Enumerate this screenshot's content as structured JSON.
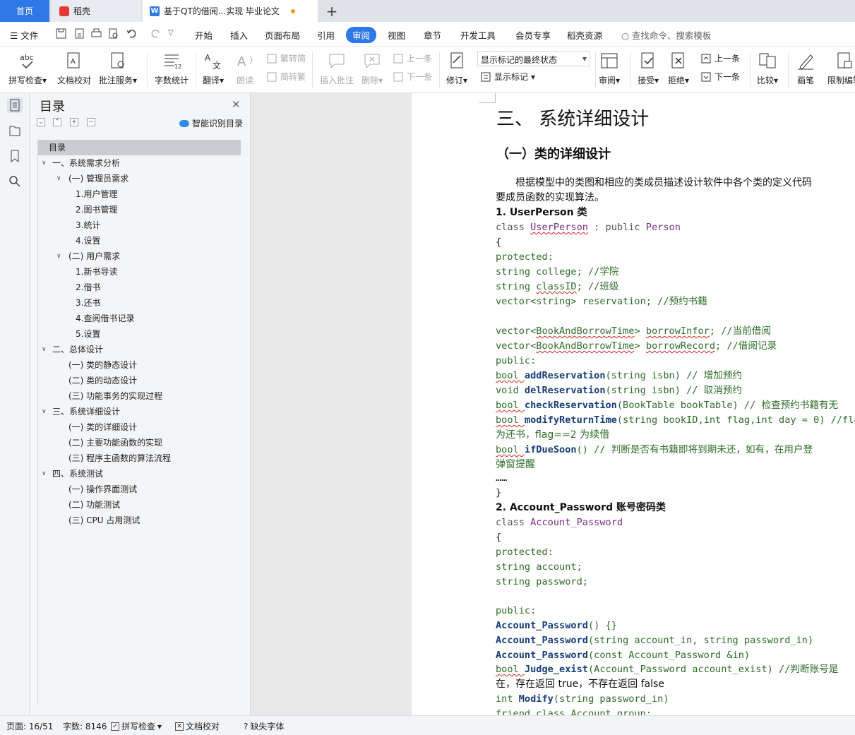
{
  "tabs": {
    "home": "首页",
    "daoke": "稻壳",
    "doc": "基于QT的借阅...实现 毕业论文",
    "new_tab": "+"
  },
  "menu": {
    "file": "文件",
    "items": [
      "开始",
      "插入",
      "页面布局",
      "引用",
      "审阅",
      "视图",
      "章节",
      "开发工具",
      "会员专享",
      "稻壳资源"
    ],
    "search": "查找命令、搜索模板"
  },
  "ribbon": {
    "spell": "拼写检查",
    "proof": "文档校对",
    "annotate": "批注服务",
    "wordcount": "字数统计",
    "translate": "翻译",
    "read": "朗读",
    "trad": "繁转简",
    "simp": "简转繁",
    "insert_comment": "插入批注",
    "delete": "删除",
    "prev_comment": "上一条",
    "next_comment": "下一条",
    "revise": "修订",
    "markup_state": "显示标记的最终状态",
    "show_markup": "显示标记",
    "review": "审阅",
    "accept": "接受",
    "reject": "拒绝",
    "prev": "上一条",
    "next": "下一条",
    "compare": "比较",
    "pen": "画笔",
    "restrict": "限制编辑"
  },
  "toc": {
    "title": "目录",
    "smart": "智能识别目录",
    "items": [
      {
        "text": "目录",
        "level": 0,
        "caret": ""
      },
      {
        "text": "一、系统需求分析",
        "level": 1,
        "caret": "v"
      },
      {
        "text": "(一) 管理员需求",
        "level": 2,
        "caret": "v"
      },
      {
        "text": "1.用户管理",
        "level": 3,
        "caret": ""
      },
      {
        "text": "2.图书管理",
        "level": 3,
        "caret": ""
      },
      {
        "text": "3.统计",
        "level": 3,
        "caret": ""
      },
      {
        "text": "4.设置",
        "level": 3,
        "caret": ""
      },
      {
        "text": "(二) 用户需求",
        "level": 2,
        "caret": "v"
      },
      {
        "text": "1.新书导读",
        "level": 3,
        "caret": ""
      },
      {
        "text": "2.借书",
        "level": 3,
        "caret": ""
      },
      {
        "text": "3.还书",
        "level": 3,
        "caret": ""
      },
      {
        "text": "4.查阅借书记录",
        "level": 3,
        "caret": ""
      },
      {
        "text": "5.设置",
        "level": 3,
        "caret": ""
      },
      {
        "text": "二、总体设计",
        "level": 1,
        "caret": "v"
      },
      {
        "text": "(一) 类的静态设计",
        "level": 2,
        "caret": ""
      },
      {
        "text": "(二) 类的动态设计",
        "level": 2,
        "caret": ""
      },
      {
        "text": "(三) 功能事务的实现过程",
        "level": 2,
        "caret": ""
      },
      {
        "text": "三、系统详细设计",
        "level": 1,
        "caret": "v"
      },
      {
        "text": "(一) 类的详细设计",
        "level": 2,
        "caret": ""
      },
      {
        "text": "(二) 主要功能函数的实现",
        "level": 2,
        "caret": ""
      },
      {
        "text": "(三) 程序主函数的算法流程",
        "level": 2,
        "caret": ""
      },
      {
        "text": "四、系统测试",
        "level": 1,
        "caret": "v"
      },
      {
        "text": "(一) 操作界面测试",
        "level": 2,
        "caret": ""
      },
      {
        "text": "(二) 功能测试",
        "level": 2,
        "caret": ""
      },
      {
        "text": "(三) CPU 占用测试",
        "level": 2,
        "caret": ""
      }
    ]
  },
  "doc": {
    "h1": "三、 系统详细设计",
    "h2": "（一）类的详细设计",
    "para1": "根据模型中的类图和相应的类成员描述设计软件中各个类的定义代码",
    "para2": "要成员函数的实现算法。",
    "sec1": "1. UserPerson 类",
    "sec2": "2. Account_Password 账号密码类",
    "code1": {
      "l1a": "class ",
      "l1b": "UserPerson",
      "l1c": " : public ",
      "l1d": "Person",
      "brace_open": "{",
      "protected": "protected:",
      "college": "    string college; //学院",
      "classID_a": "    string ",
      "classID_b": "classID",
      "classID_c": "; //班级",
      "reservation": "    vector<string> reservation; //预约书籍",
      "v1a": "    vector<",
      "v1b": "BookAndBorrowTime",
      "v1c": "> ",
      "v1d": "borrowInfor",
      "v1e": "; //当前借阅",
      "v2a": "    vector<",
      "v2b": "BookAndBorrowTime",
      "v2c": "> ",
      "v2d": "borrowRecord",
      "v2e": "; //借阅记录",
      "public": "public:",
      "f1a": "    bool ",
      "f1b": "addReservation",
      "f1c": "(string isbn) // 增加预约",
      "f2a": "    void ",
      "f2b": "delReservation",
      "f2c": "(string isbn) // 取消预约",
      "f3a": "    bool ",
      "f3b": "checkReservation",
      "f3c": "(BookTable bookTable) // 检查预约书籍有无",
      "f4a": "    bool ",
      "f4b": "modifyReturnTime",
      "f4c": "(string bookID,int flag,int day = 0) //fla",
      "f4d": "为还书，flag==2 为续借",
      "f5a": "    bool ",
      "f5b": "ifDueSoon",
      "f5c": "() // 判断是否有书籍即将到期未还，如有，在用户登",
      "f5d": "弹窗提醒",
      "dots": "      ……",
      "brace_close": "}"
    },
    "code2": {
      "l1a": "class ",
      "l1b": "Account_Password",
      "brace_open": "{",
      "protected": "protected:",
      "acc": "    string account;",
      "pwd": "    string password;",
      "public": "public:",
      "c1a": "    ",
      "c1b": "Account_Password",
      "c1c": "()  {}",
      "c2a": "    ",
      "c2b": "Account_Password",
      "c2c": "(string account_in, string password_in)",
      "c3a": "    ",
      "c3b": "Account_Password",
      "c3c": "(const Account_Password &in)",
      "c4a": "    bool ",
      "c4b": "Judge_exist",
      "c4c": "(Account_Password account_exist) //判断账号是",
      "c4d": "在，存在返回 true，不存在返回 false",
      "c5a": "    int ",
      "c5b": "Modify",
      "c5c": "(string password_in)",
      "c6": "    friend class Account_group;"
    }
  },
  "status": {
    "page": "页面: 16/51",
    "words": "字数: 8146",
    "spell": "拼写检查",
    "proof": "文档校对",
    "font": "缺失字体"
  }
}
